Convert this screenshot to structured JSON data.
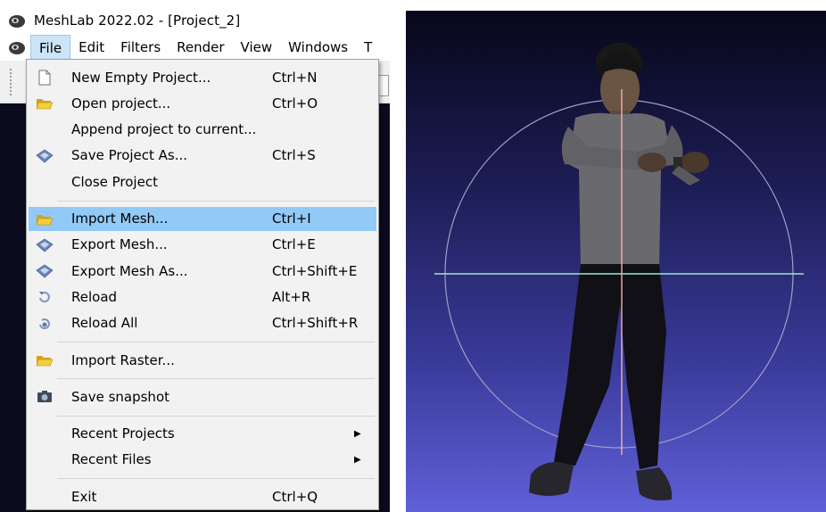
{
  "window": {
    "title": "MeshLab 2022.02 - [Project_2]"
  },
  "menubar": {
    "items": [
      "File",
      "Edit",
      "Filters",
      "Render",
      "View",
      "Windows",
      "T"
    ]
  },
  "file_menu": {
    "groups": [
      [
        {
          "label": "New Empty Project...",
          "shortcut": "Ctrl+N",
          "icon": "new-document-icon"
        },
        {
          "label": "Open project...",
          "shortcut": "Ctrl+O",
          "icon": "open-folder-icon"
        },
        {
          "label": "Append project to current...",
          "shortcut": "",
          "icon": ""
        },
        {
          "label": "Save Project As...",
          "shortcut": "Ctrl+S",
          "icon": "save-diamond-icon"
        },
        {
          "label": "Close Project",
          "shortcut": "",
          "icon": ""
        }
      ],
      [
        {
          "label": "Import Mesh...",
          "shortcut": "Ctrl+I",
          "icon": "open-folder-icon",
          "highlighted": true
        },
        {
          "label": "Export Mesh...",
          "shortcut": "Ctrl+E",
          "icon": "save-diamond-icon"
        },
        {
          "label": "Export Mesh As...",
          "shortcut": "Ctrl+Shift+E",
          "icon": "save-diamond-icon"
        },
        {
          "label": "Reload",
          "shortcut": "Alt+R",
          "icon": "reload-icon"
        },
        {
          "label": "Reload All",
          "shortcut": "Ctrl+Shift+R",
          "icon": "reload-all-icon"
        }
      ],
      [
        {
          "label": "Import Raster...",
          "shortcut": "",
          "icon": "open-folder-icon"
        }
      ],
      [
        {
          "label": "Save snapshot",
          "shortcut": "",
          "icon": "camera-icon"
        }
      ],
      [
        {
          "label": "Recent Projects",
          "shortcut": "",
          "icon": "",
          "submenu": true
        },
        {
          "label": "Recent Files",
          "shortcut": "",
          "icon": "",
          "submenu": true
        }
      ],
      [
        {
          "label": "Exit",
          "shortcut": "Ctrl+Q",
          "icon": ""
        }
      ]
    ]
  },
  "colors": {
    "highlight": "#91c9f7",
    "menu_bg": "#f2f2f2",
    "viewport_top": "#07071a",
    "viewport_bottom": "#6060d8",
    "trackball_horizontal": "#9ee8c8",
    "trackball_vertical": "#f2b3b3"
  }
}
